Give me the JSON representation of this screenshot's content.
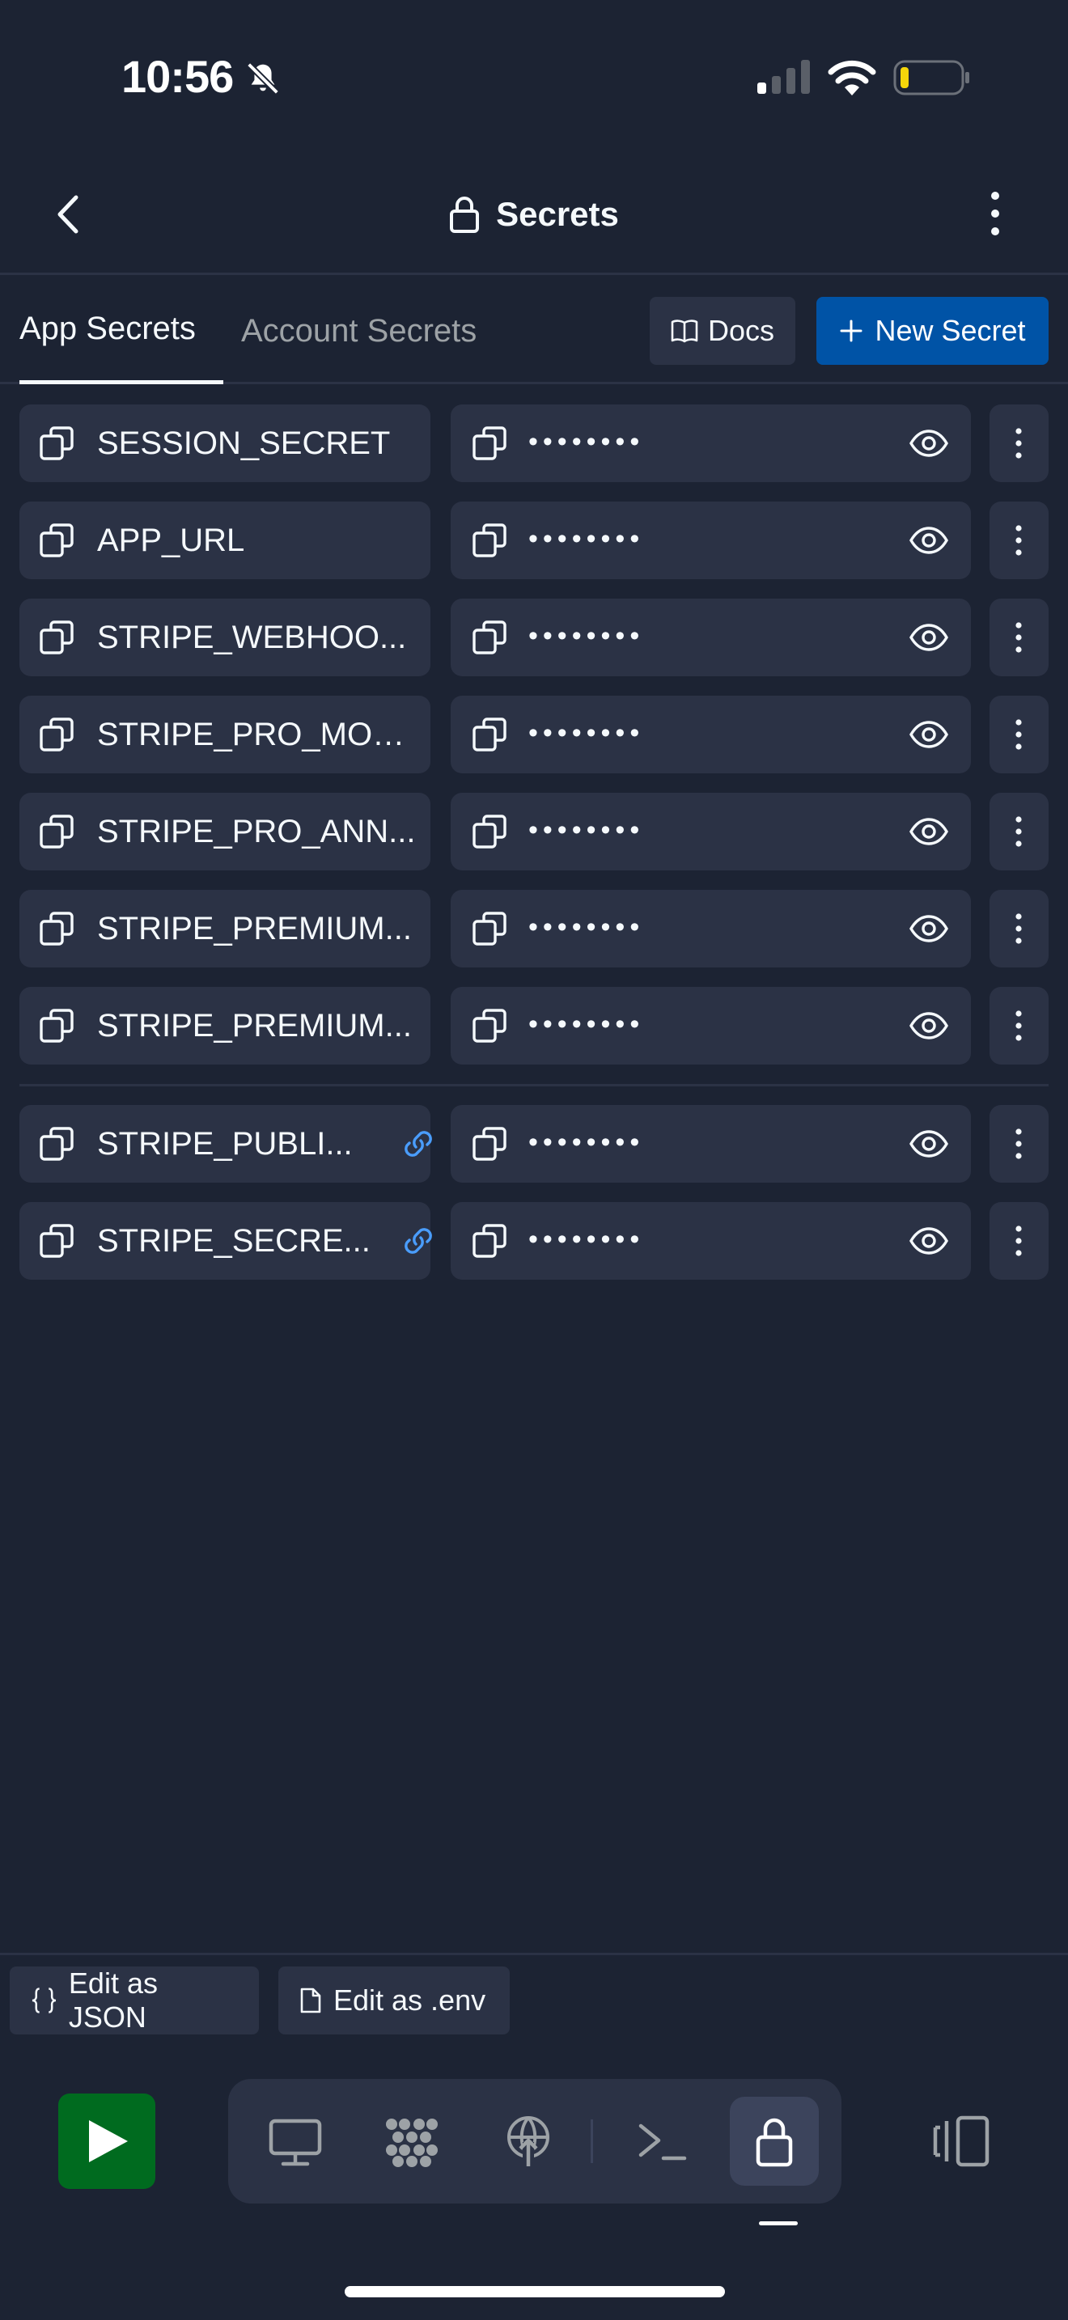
{
  "status_bar": {
    "time": "10:56"
  },
  "header": {
    "title": "Secrets"
  },
  "tabs": [
    {
      "label": "App Secrets",
      "active": true
    },
    {
      "label": "Account Secrets",
      "active": false
    }
  ],
  "actions": {
    "docs_label": "Docs",
    "new_secret_label": "New Secret"
  },
  "secrets": [
    {
      "key": "SESSION_SECRET",
      "value_masked": "••••••••",
      "linked": false
    },
    {
      "key": "APP_URL",
      "value_masked": "••••••••",
      "linked": false
    },
    {
      "key": "STRIPE_WEBHOO...",
      "value_masked": "••••••••",
      "linked": false
    },
    {
      "key": "STRIPE_PRO_MON...",
      "value_masked": "••••••••",
      "linked": false
    },
    {
      "key": "STRIPE_PRO_ANN...",
      "value_masked": "••••••••",
      "linked": false
    },
    {
      "key": "STRIPE_PREMIUM...",
      "value_masked": "••••••••",
      "linked": false
    },
    {
      "key": "STRIPE_PREMIUM...",
      "value_masked": "••••••••",
      "linked": false
    },
    {
      "key": "STRIPE_PUBLI...",
      "value_masked": "••••••••",
      "linked": true
    },
    {
      "key": "STRIPE_SECRE...",
      "value_masked": "••••••••",
      "linked": true
    }
  ],
  "edit_bar": {
    "json_label": "Edit as JSON",
    "env_label": "Edit as .env"
  },
  "toolbar": {
    "tools": [
      "run-icon",
      "desktop-icon",
      "packages-icon",
      "deploy-icon",
      "terminal-icon",
      "lock-icon"
    ],
    "active_tool": "lock-icon"
  },
  "colors": {
    "background": "#1c2333",
    "surface": "#2b3245",
    "primary": "#0053a6",
    "run": "#006b1f",
    "link": "#4a9dfc",
    "muted_text": "#9da2a6"
  }
}
